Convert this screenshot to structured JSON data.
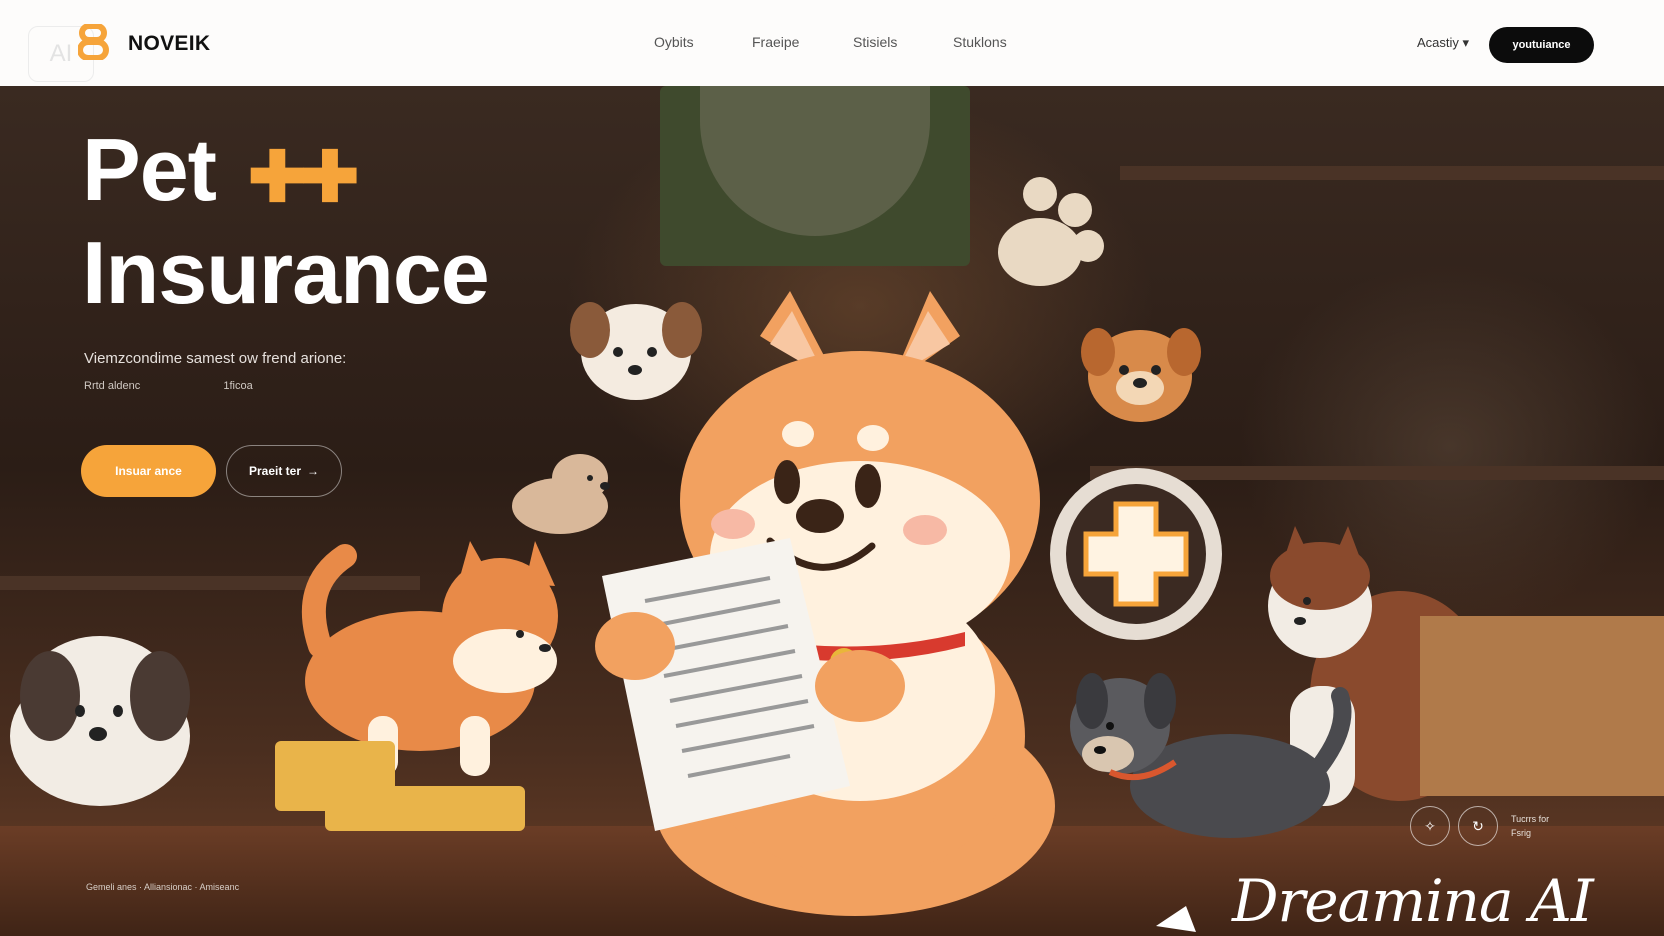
{
  "header": {
    "brand": "NOVEIK",
    "logo_ghost": "AI",
    "nav": [
      "Oybits",
      "Fraeipe",
      "Stisiels",
      "Stuklons"
    ],
    "account_label": "Acastiy ▾",
    "cta_label": "youtuiance"
  },
  "hero": {
    "title_line1": "Pet",
    "title_symbol": "✚✚",
    "title_line2": "Insurance",
    "subtitle": "Viemzcondime samest ow frend arione:",
    "meta_left": "Rrtd aldenc",
    "meta_right": "1ficoa",
    "primary_button": "Insuar ance",
    "secondary_button": "Praeit ter",
    "secondary_arrow": "→",
    "footer_text": "Gemeli anes  ·  Alliansionac  ·  Amiseanc"
  },
  "corner": {
    "note_line1": "Tucrrs for",
    "note_line2": "Fsrig"
  },
  "watermark": {
    "text": "Dreamina AI"
  },
  "colors": {
    "accent": "#f6a43a",
    "dark": "#0c0c0c",
    "header_bg": "#fdfcfb"
  }
}
